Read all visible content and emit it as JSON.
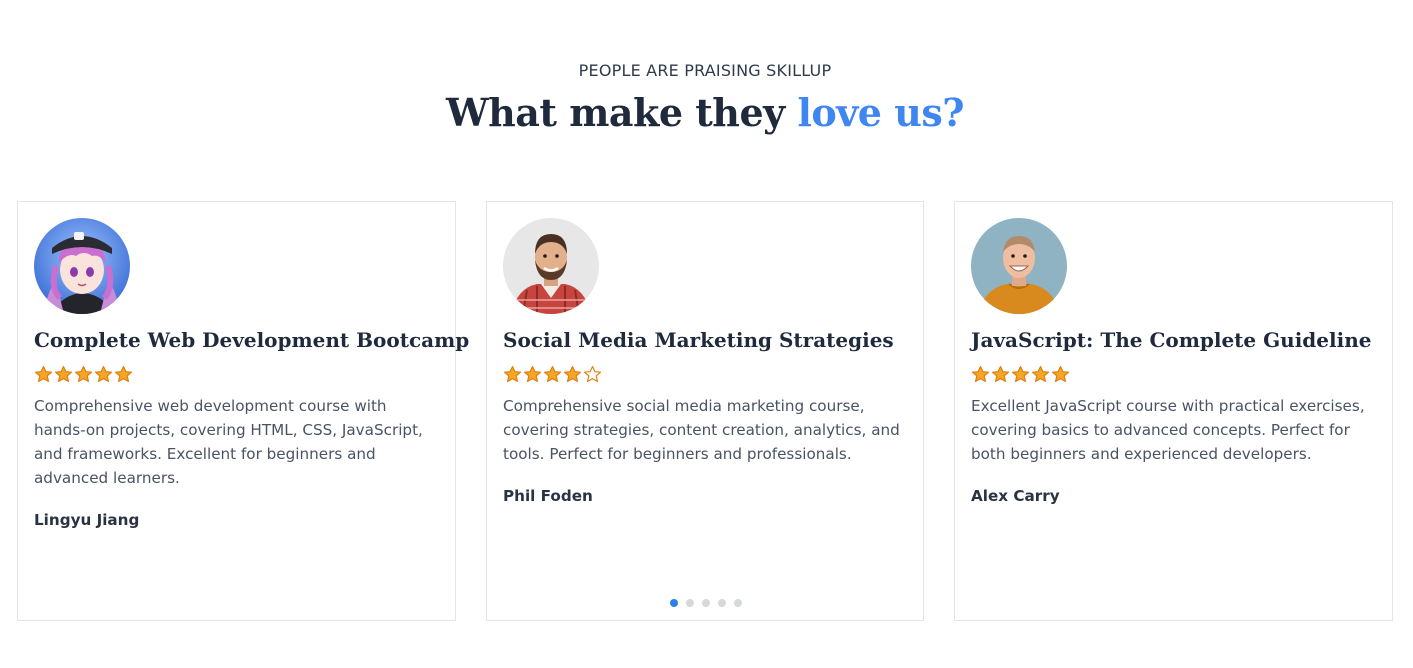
{
  "section": {
    "eyebrow": "PEOPLE ARE PRAISING SKILLUP",
    "headline_main": "What make they ",
    "headline_accent": "love us?"
  },
  "colors": {
    "accent": "#3f86f0",
    "heading": "#1f2a3c",
    "star": "#f5a623",
    "dot_active": "#2b7fe6",
    "dot_inactive": "#d5d8dd"
  },
  "testimonials": [
    {
      "course": "Complete Web Development Bootcamp",
      "rating": 5,
      "review": "Comprehensive web development course with hands-on projects, covering HTML, CSS, JavaScript, and frameworks. Excellent for beginners and advanced learners.",
      "name": "Lingyu Jiang",
      "avatar_icon": "anime-girl-avatar"
    },
    {
      "course": "Social Media Marketing Strategies",
      "rating": 4,
      "review": "Comprehensive social media marketing course, covering strategies, content creation, analytics, and tools. Perfect for beginners and professionals.",
      "name": "Phil Foden",
      "avatar_icon": "bearded-man-avatar"
    },
    {
      "course": "JavaScript: The Complete Guideline",
      "rating": 5,
      "review": "Excellent JavaScript course with practical exercises, covering basics to advanced concepts. Perfect for both beginners and experienced developers.",
      "name": "Alex Carry",
      "avatar_icon": "smiling-man-avatar"
    }
  ],
  "carousel": {
    "total_pages": 5,
    "active_page": 1
  }
}
